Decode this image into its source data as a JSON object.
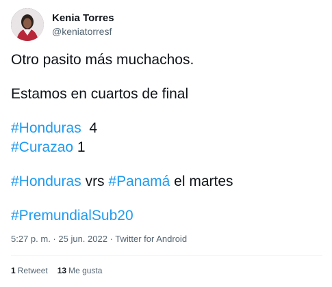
{
  "user": {
    "display_name": "Kenia Torres",
    "handle": "@keniatorresf"
  },
  "tweet": {
    "line1": "Otro pasito más muchachos.",
    "line2": "Estamos en cuartos de final",
    "hashtag_honduras": "#Honduras",
    "score_honduras": "  4",
    "hashtag_curazao": "#Curazao",
    "score_curazao": " 1",
    "match_hashtag_honduras": "#Honduras",
    "vrs": " vrs ",
    "match_hashtag_panama": "#Panamá",
    "match_when": " el martes",
    "hashtag_premundial": "#PremundialSub20"
  },
  "meta": {
    "time": "5:27 p. m.",
    "separator1": " · ",
    "date": "25 jun. 2022",
    "separator2": " · ",
    "source": "Twitter for Android"
  },
  "stats": {
    "retweets_count": "1",
    "retweets_label": "Retweet",
    "likes_count": "13",
    "likes_label": "Me gusta"
  },
  "colors": {
    "hashtag": "#1d9bf0",
    "text": "#0f1419",
    "secondary": "#536471"
  }
}
